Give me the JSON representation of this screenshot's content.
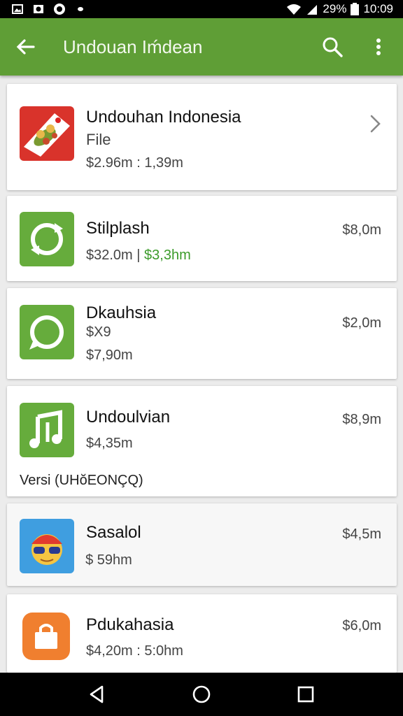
{
  "status_bar": {
    "battery": "29%",
    "time": "10:09"
  },
  "app_bar": {
    "title": "Undouan Iḿdean"
  },
  "items": [
    {
      "name": "Undouhan Indonesia",
      "subtitle": "File",
      "detail": "$2.96m : 1,39m"
    },
    {
      "name": "Stilplash",
      "detail": "$32.0m |",
      "detail_green": "$3,3hm",
      "price": "$8,0m"
    },
    {
      "name": "Dkauhsia",
      "subtitle": "$X9",
      "detail": "$7,90m",
      "price": "$2,0m"
    },
    {
      "name": "Undoulvian",
      "detail": "$4,35m",
      "extra": "Versi (UHŏEONÇQ)",
      "price": "$8,9m"
    },
    {
      "name": "Sasalol",
      "detail": "$ 59hm",
      "price": "$4,5m"
    },
    {
      "name": "Pdukahasia",
      "detail": "$4,20m : 5:0hm",
      "price": "$6,0m"
    }
  ],
  "colors": {
    "app_bar": "#5f9e36",
    "accent_green": "#3b9b2a",
    "nav_bar": "#000000"
  },
  "icons": [
    "back-arrow-icon",
    "search-icon",
    "more-vert-icon",
    "chevron-right-icon",
    "food-app-icon",
    "refresh-app-icon",
    "circle-app-icon",
    "music-app-icon",
    "face-app-icon",
    "bag-app-icon",
    "back-triangle-icon",
    "home-circle-icon",
    "recents-square-icon"
  ]
}
